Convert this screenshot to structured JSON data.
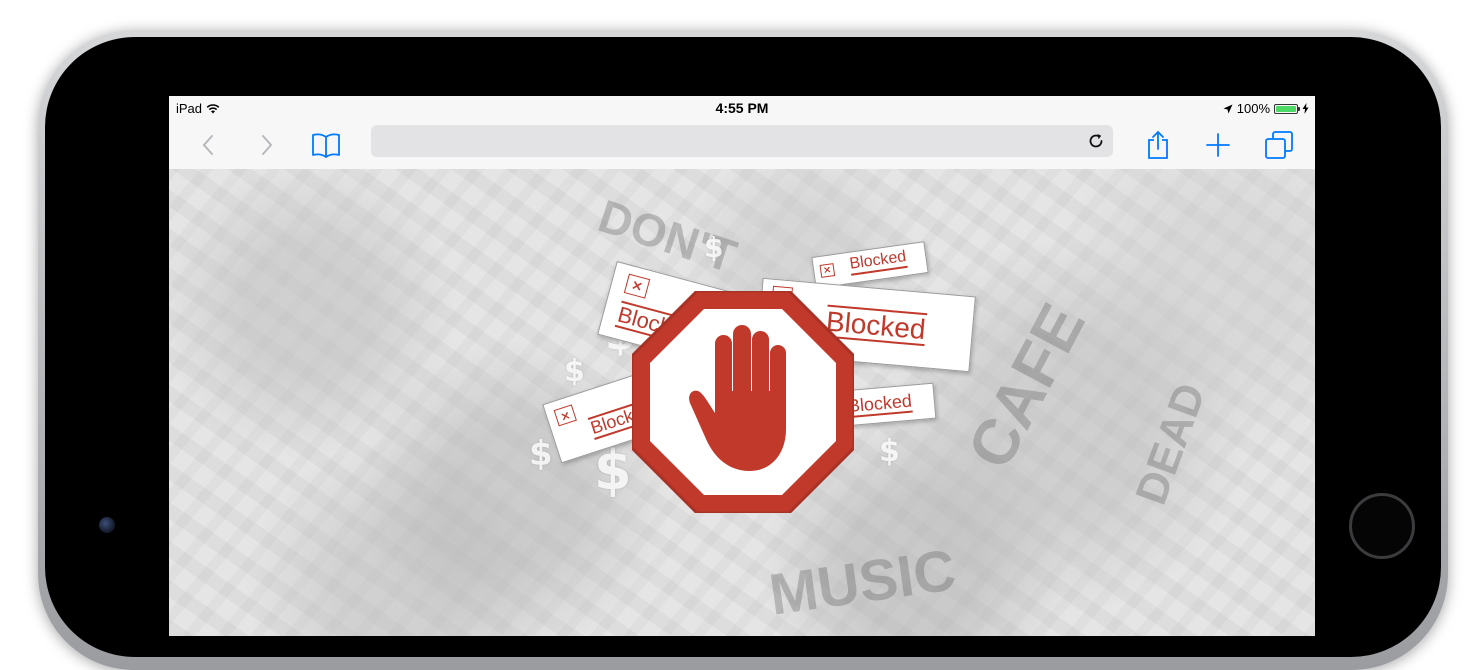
{
  "status_bar": {
    "device": "iPad",
    "time": "4:55 PM",
    "battery": "100%",
    "battery_level": 1.0
  },
  "toolbar": {
    "back_icon": "chevron-left-icon",
    "forward_icon": "chevron-right-icon",
    "bookmarks_icon": "book-icon",
    "address_value": "",
    "address_placeholder": "",
    "reload_icon": "reload-icon",
    "share_icon": "share-icon",
    "new_tab_icon": "plus-icon",
    "tabs_icon": "tabs-icon"
  },
  "content": {
    "blocked_labels": [
      "Blocked",
      "Blocked",
      "Blocked",
      "Blocked",
      "Blocked"
    ],
    "dollar_sign": "$",
    "stop_icon": "stop-hand-icon",
    "background_words": [
      "DON'T",
      "MUSIC",
      "DEAD",
      "CAFE"
    ]
  },
  "colors": {
    "accent": "#007aff",
    "blocked_red": "#c0392b",
    "battery_green": "#4cd964"
  }
}
